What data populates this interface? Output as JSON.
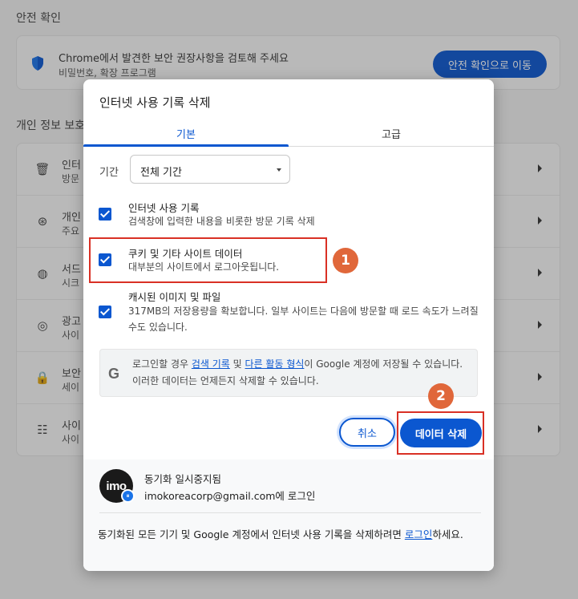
{
  "background": {
    "safety_section_title": "안전 확인",
    "safety_card": {
      "title": "Chrome에서 발견한 보안 권장사항을 검토해 주세요",
      "subtitle": "비밀번호, 확장 프로그램",
      "button": "안전 확인으로 이동"
    },
    "privacy_section_title": "개인 정보 보호",
    "privacy_rows": [
      {
        "icon": "trash-icon",
        "title": "인터",
        "sub": "방문"
      },
      {
        "icon": "privacy-guide-icon",
        "title": "개인",
        "sub": "주요"
      },
      {
        "icon": "cookie-icon",
        "title": "서드",
        "sub": "시크"
      },
      {
        "icon": "ad-privacy-icon",
        "title": "광고",
        "sub": "사이"
      },
      {
        "icon": "lock-icon",
        "title": "보안",
        "sub": "세이"
      },
      {
        "icon": "tune-icon",
        "title": "사이",
        "sub": "사이"
      }
    ]
  },
  "dialog": {
    "title": "인터넷 사용 기록 삭제",
    "tabs": [
      "기본",
      "고급"
    ],
    "active_tab": "기본",
    "range_label": "기간",
    "range_value": "전체 기간",
    "options": [
      {
        "title": "인터넷 사용 기록",
        "desc": "검색창에 입력한 내용을 비롯한 방문 기록 삭제",
        "checked": true
      },
      {
        "title": "쿠키 및 기타 사이트 데이터",
        "desc": "대부분의 사이트에서 로그아웃됩니다.",
        "checked": true
      },
      {
        "title": "캐시된 이미지 및 파일",
        "desc": "317MB의 저장용량을 확보합니다. 일부 사이트는 다음에 방문할 때 로드 속도가 느려질 수도 있습니다.",
        "checked": true
      }
    ],
    "info": {
      "prefix": "로그인할 경우 ",
      "link1": "검색 기록",
      "mid": " 및 ",
      "link2": "다른 활동 형식",
      "suffix": "이 Google 계정에 저장될 수 있습니다. 이러한 데이터는 언제든지 삭제할 수 있습니다."
    },
    "cancel_label": "취소",
    "delete_label": "데이터 삭제",
    "account": {
      "avatar_text": "imo",
      "sync_status": "동기화 일시중지됨",
      "email_line": "imokoreacorp@gmail.com에 로그인"
    },
    "footer_note": {
      "prefix": "동기화된 모든 기기 및 Google 계정에서 인터넷 사용 기록을 삭제하려면 ",
      "link": "로그인",
      "suffix": "하세요."
    }
  },
  "annotations": {
    "badge_1": "1",
    "badge_2": "2"
  },
  "colors": {
    "accent": "#0b57d0",
    "annotation_red": "#d93025",
    "badge_orange": "#e0673a"
  }
}
